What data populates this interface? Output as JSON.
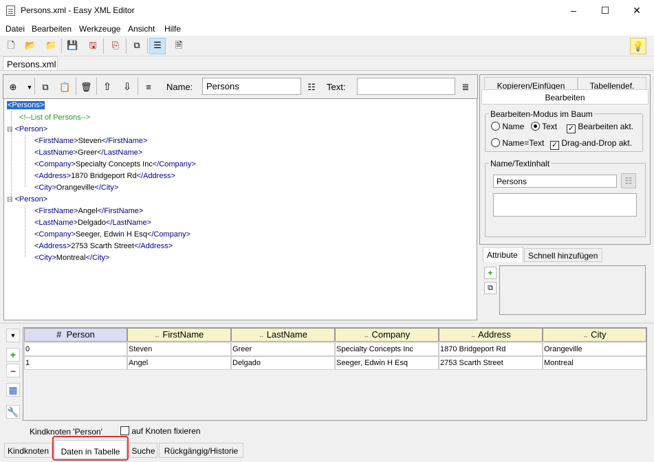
{
  "window": {
    "title": "Persons.xml - Easy XML Editor",
    "minimize": "–",
    "maximize": "☐",
    "close": "✕"
  },
  "menu": [
    "Datei",
    "Bearbeiten",
    "Werkzeuge",
    "Ansicht",
    "Hilfe"
  ],
  "doc_tab": "Persons.xml",
  "editor_toolbar": {
    "name_label": "Name:",
    "name_value": "Persons",
    "text_label": "Text:",
    "text_value": ""
  },
  "tree": {
    "root": "<Persons>",
    "comment": "<!--List of Persons-->",
    "persons": [
      {
        "tag": "<Person>",
        "fields": [
          [
            "<FirstName>",
            "Steven",
            "</FirstName>"
          ],
          [
            "<LastName>",
            "Greer",
            "</LastName>"
          ],
          [
            "<Company>",
            "Specialty Concepts Inc",
            "</Company>"
          ],
          [
            "<Address>",
            "1870 Bridgeport Rd",
            "</Address>"
          ],
          [
            "<City>",
            "Orangeville",
            "</City>"
          ]
        ]
      },
      {
        "tag": "<Person>",
        "fields": [
          [
            "<FirstName>",
            "Angel",
            "</FirstName>"
          ],
          [
            "<LastName>",
            "Delgado",
            "</LastName>"
          ],
          [
            "<Company>",
            "Seeger, Edwin H Esq",
            "</Company>"
          ],
          [
            "<Address>",
            "2753 Scarth Street",
            "</Address>"
          ],
          [
            "<City>",
            "Montreal",
            "</City>"
          ]
        ]
      }
    ]
  },
  "right_panel": {
    "tabs": [
      "Kopieren/Einfügen",
      "Tabellendef.",
      "Bearbeiten"
    ],
    "mode_group": "Bearbeiten-Modus im Baum",
    "opt_name": "Name",
    "opt_text": "Text",
    "opt_name_text": "Name=Text",
    "chk_edit": "Bearbeiten akt.",
    "chk_dnd": "Drag-and-Drop akt.",
    "content_group": "Name/Textinhalt",
    "content_value": "Persons",
    "attr_tabs": [
      "Attribute",
      "Schnell hinzufügen"
    ]
  },
  "table": {
    "headers": [
      "#",
      "Person",
      "FirstName",
      "LastName",
      "Company",
      "Address",
      "City"
    ],
    "rows": [
      [
        "0",
        "Steven",
        "Greer",
        "Specialty Concepts Inc",
        "1870 Bridgeport Rd",
        "Orangeville"
      ],
      [
        "1",
        "Angel",
        "Delgado",
        "Seeger, Edwin H Esq",
        "2753 Scarth Street",
        "Montreal"
      ]
    ],
    "footer_label": "Kindknoten 'Person'",
    "fix_label": "auf Knoten fixieren"
  },
  "bottom_tabs": [
    "Kindknoten",
    "Daten in Tabelle",
    "Suche",
    "Rückgängig/Historie"
  ],
  "colors": {
    "highlight": "#e03030",
    "selection": "#2b6bd2",
    "tag": "#00008b",
    "comment": "#1e9b1e"
  }
}
